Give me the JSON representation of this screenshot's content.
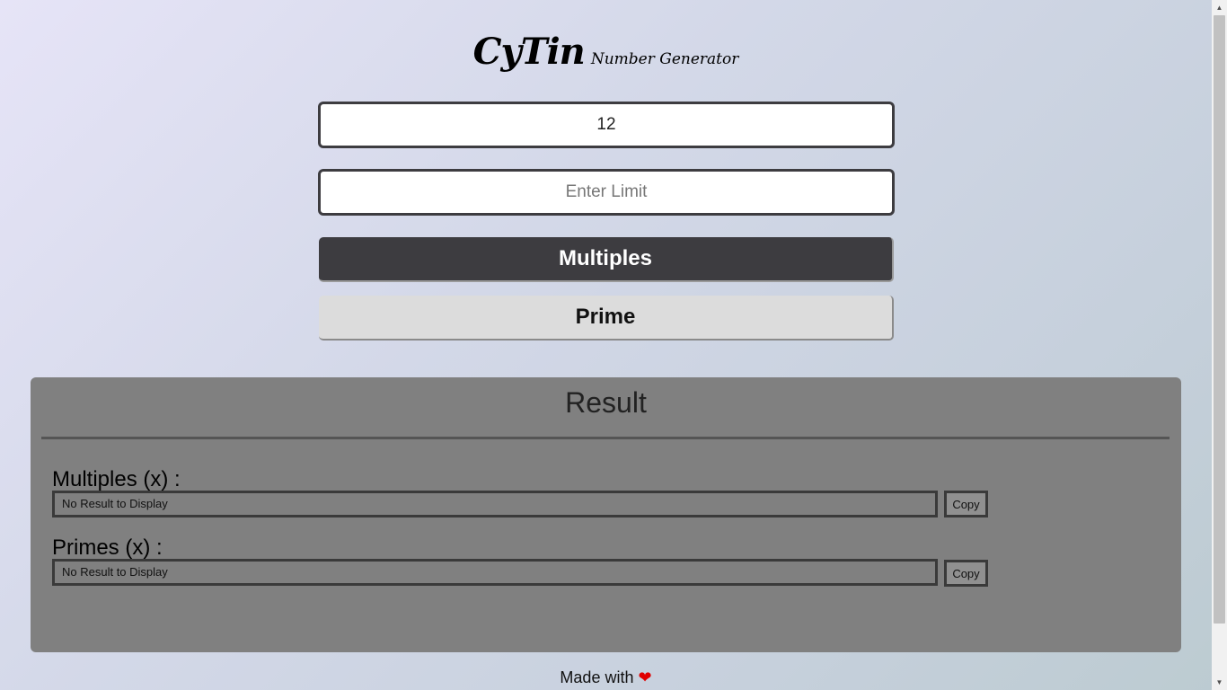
{
  "header": {
    "brand": "CyTin",
    "subtitle": "Number Generator"
  },
  "form": {
    "number_value": "12",
    "number_placeholder": "",
    "limit_value": "",
    "limit_placeholder": "Enter Limit",
    "multiples_button": "Multiples",
    "prime_button": "Prime"
  },
  "result": {
    "title": "Result",
    "multiples_label": "Multiples (x) :",
    "multiples_output": "No Result to Display",
    "primes_label": "Primes (x) :",
    "primes_output": "No Result to Display",
    "copy_label": "Copy"
  },
  "footer": {
    "text": "Made with",
    "heart_icon": "heart-icon"
  },
  "colors": {
    "accent_dark": "#3d3c40",
    "result_panel": "#808080",
    "heart": "#e00000"
  }
}
